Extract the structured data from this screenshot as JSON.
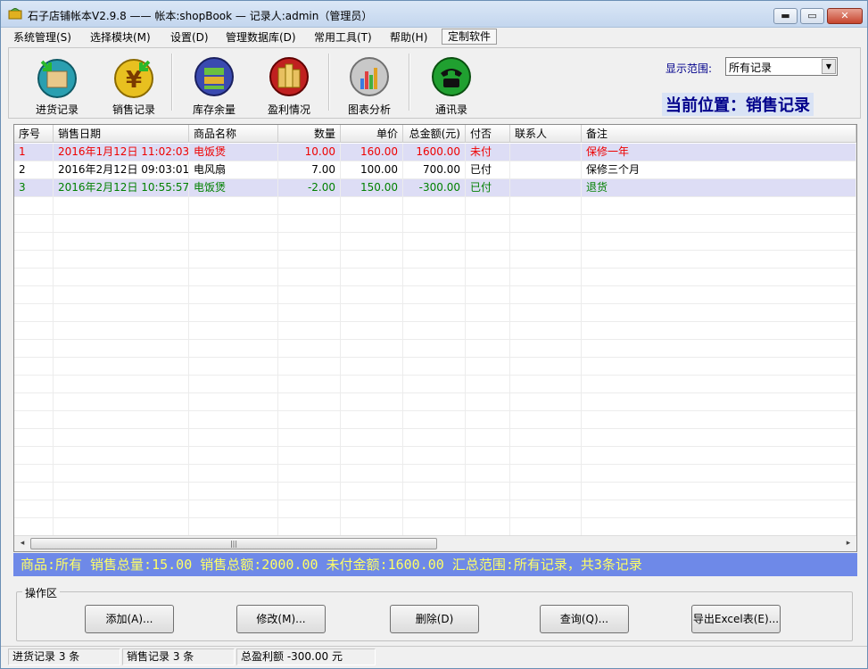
{
  "window": {
    "title": "石子店铺帐本V2.9.8  ——  帐本:shopBook — 记录人:admin（管理员）",
    "min_label": "▬",
    "max_label": "▭",
    "close_label": "✕"
  },
  "menu": {
    "items": [
      "系统管理(S)",
      "选择模块(M)",
      "设置(D)",
      "管理数据库(D)",
      "常用工具(T)",
      "帮助(H)",
      "定制软件"
    ]
  },
  "toolbar": {
    "tools": [
      {
        "label": "进货记录",
        "icon": "inbound-box-icon"
      },
      {
        "label": "销售记录",
        "icon": "yen-coin-icon"
      },
      {
        "label": "库存余量",
        "icon": "inventory-icon"
      },
      {
        "label": "盈利情况",
        "icon": "coins-stack-icon"
      },
      {
        "label": "图表分析",
        "icon": "bar-chart-icon"
      },
      {
        "label": "通讯录",
        "icon": "telephone-icon"
      }
    ],
    "range_label": "显示范围:",
    "range_value": "所有记录",
    "location": "当前位置：销售记录"
  },
  "table": {
    "columns": [
      "序号",
      "销售日期",
      "商品名称",
      "数量",
      "单价",
      "总金额(元)",
      "付否",
      "联系人",
      "备注"
    ],
    "rows": [
      {
        "no": "1",
        "date": "2016年1月12日 11:02:03",
        "item": "电饭煲",
        "qty": "10.00",
        "price": "160.00",
        "total": "1600.00",
        "paid": "未付",
        "contact": "",
        "note": "保修一年"
      },
      {
        "no": "2",
        "date": "2016年2月12日 09:03:01",
        "item": "电风扇",
        "qty": "7.00",
        "price": "100.00",
        "total": "700.00",
        "paid": "已付",
        "contact": "",
        "note": "保修三个月"
      },
      {
        "no": "3",
        "date": "2016年2月12日 10:55:57",
        "item": "电饭煲",
        "qty": "-2.00",
        "price": "150.00",
        "total": "-300.00",
        "paid": "已付",
        "contact": "",
        "note": "退货"
      }
    ],
    "row_colors": [
      "#ee0000",
      "#000000",
      "#008000"
    ],
    "row_backgrounds": [
      "#ddddf5",
      "#ffffff",
      "#ddddf5"
    ],
    "scroll_left": "◂",
    "scroll_right": "▸",
    "scroll_grip": "|||"
  },
  "summary": {
    "text": "商品:所有  销售总量:15.00  销售总额:2000.00  未付金额:1600.00  汇总范围:所有记录，共3条记录"
  },
  "operations": {
    "legend": "操作区",
    "buttons": [
      "添加(A)...",
      "修改(M)...",
      "删除(D)",
      "查询(Q)...",
      "导出Excel表(E)..."
    ]
  },
  "statusbar": {
    "inbound": "进货记录 3 条",
    "sales": "销售记录 3 条",
    "profit": "总盈利额 -300.00 元"
  },
  "colors": {
    "accent_blue": "#00008b",
    "summary_bg": "#6e89e8",
    "summary_fg": "#ffff66"
  }
}
